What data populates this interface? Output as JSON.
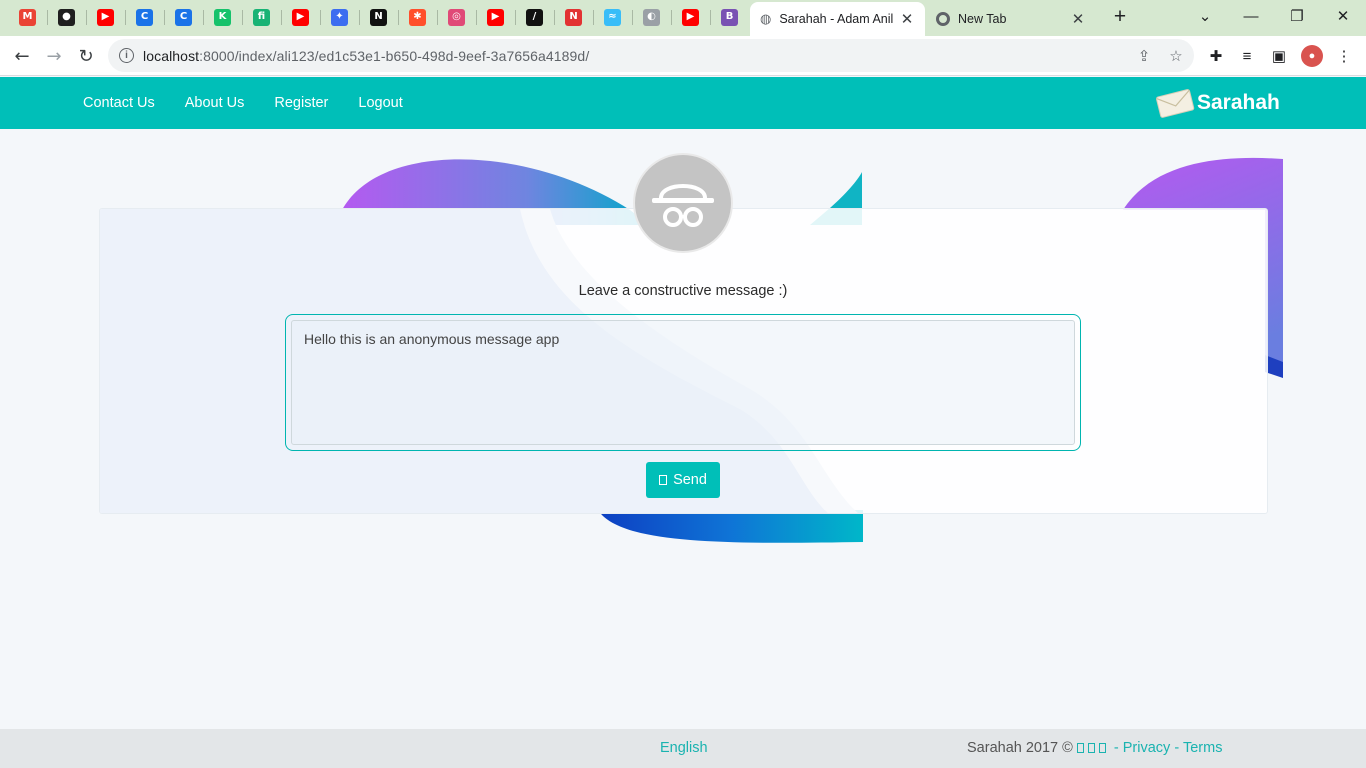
{
  "browser": {
    "pinned_tabs": [
      {
        "icon": "gmail-icon",
        "glyph": "M",
        "color": "#ea4335"
      },
      {
        "icon": "github-icon",
        "glyph": "●",
        "color": "#1f1f1f"
      },
      {
        "icon": "youtube-icon",
        "glyph": "▶",
        "color": "#ff0000"
      },
      {
        "icon": "copyleaks-icon",
        "glyph": "C",
        "color": "#1a73e8"
      },
      {
        "icon": "copyleaks-icon",
        "glyph": "C",
        "color": "#1a73e8"
      },
      {
        "icon": "bookmark-k-icon",
        "glyph": "K",
        "color": "#16c26b"
      },
      {
        "icon": "fn-icon",
        "glyph": "fi",
        "color": "#18b375"
      },
      {
        "icon": "youtube-icon",
        "glyph": "▶",
        "color": "#ff0000"
      },
      {
        "icon": "puzzle-blocks-icon",
        "glyph": "✦",
        "color": "#3c6df0"
      },
      {
        "icon": "next-icon",
        "glyph": "N",
        "color": "#111111"
      },
      {
        "icon": "asterisk-icon",
        "glyph": "✱",
        "color": "#ff4f2b"
      },
      {
        "icon": "spiral-icon",
        "glyph": "◎",
        "color": "#e04a77"
      },
      {
        "icon": "youtube-icon",
        "glyph": "▶",
        "color": "#ff0000"
      },
      {
        "icon": "slash-icon",
        "glyph": "/",
        "color": "#111111"
      },
      {
        "icon": "netlify-icon",
        "glyph": "N",
        "color": "#e23232"
      },
      {
        "icon": "tailwind-icon",
        "glyph": "≈",
        "color": "#38bdf8"
      },
      {
        "icon": "globe-icon",
        "glyph": "◐",
        "color": "#9aa0a6"
      },
      {
        "icon": "youtube-icon",
        "glyph": "▶",
        "color": "#ff0000"
      },
      {
        "icon": "bootstrap-icon",
        "glyph": "B",
        "color": "#7952b3"
      }
    ],
    "tabs": [
      {
        "title": "Sarahah - Adam Anil"
      },
      {
        "title": "New Tab"
      }
    ],
    "url_host": "localhost",
    "url_rest": ":8000/index/ali123/ed1c53e1-b650-498d-9eef-3a7656a4189d/"
  },
  "site": {
    "nav": [
      "Contact Us",
      "About Us",
      "Register",
      "Logout"
    ],
    "brand": "Sarahah",
    "prompt": "Leave a constructive message :)",
    "message_value": "Hello this is an anonymous message app",
    "send_label": "Send",
    "footer": {
      "language": "English",
      "copyright": "Sarahah 2017 ©",
      "sep1": "-",
      "privacy": "Privacy",
      "sep2": "-",
      "terms": "Terms"
    },
    "colors": {
      "accent": "#00bfb8",
      "footer_bg": "#e3e6e8"
    }
  }
}
